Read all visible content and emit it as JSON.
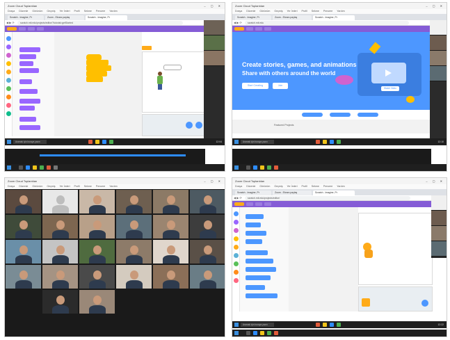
{
  "pane1": {
    "title": "Zoom Cloud Toplantıları",
    "menu": [
      "Dosya",
      "Düzenle",
      "Görünüm",
      "Geçmiş",
      "Yer İmleri",
      "Profil",
      "Sekme",
      "Pencere",
      "Yardım"
    ],
    "tabs": [
      "Scratch - Imagine, Pr",
      "Zoom - Ekranı paylaş",
      "Scratch - Imagine, Pr"
    ],
    "url": "scratch.mit.edu/projects/editor/?tutorial=getStarted",
    "taskbar_search": "Aramak için buraya yazın",
    "clock": "12:04"
  },
  "pane2": {
    "title": "Zoom Cloud Toplantıları",
    "menu": [
      "Dosya",
      "Düzenle",
      "Görünüm",
      "Geçmiş",
      "Yer İmleri",
      "Profil",
      "Sekme",
      "Pencere",
      "Yardım"
    ],
    "tabs": [
      "Scratch - Imagine, Pr",
      "Zoom - Ekranı paylaş",
      "Scratch - Imagine, Pr"
    ],
    "url": "scratch.mit.edu",
    "hero_line1": "Create stories, games, and animations",
    "hero_line2": "Share with others around the world",
    "start_creating": "Start Creating",
    "join_label": "Join",
    "watch_video": "Watch Video",
    "featured": "Featured Projects",
    "taskbar_search": "Aramak için buraya yazın",
    "clock": "12:10"
  },
  "pane3": {
    "title": "Zoom Cloud Toplantıları",
    "menu": [
      "Dosya",
      "Düzenle",
      "Görünüm",
      "Geçmiş",
      "Yer İmleri",
      "Profil",
      "Sekme",
      "Pencere",
      "Yardım"
    ]
  },
  "pane4": {
    "title": "Zoom Cloud Toplantıları",
    "menu": [
      "Dosya",
      "Düzenle",
      "Görünüm",
      "Geçmiş",
      "Yer İmleri",
      "Profil",
      "Sekme",
      "Pencere",
      "Yardım"
    ],
    "tabs": [
      "Scratch - Imagine, Pr",
      "Zoom - Ekranı paylaş",
      "Scratch - Imagine, Pr"
    ],
    "url": "scratch.mit.edu/projects/editor/",
    "taskbar_search": "Aramak için buraya yazın",
    "clock": "12:22"
  },
  "colors": {
    "scratch_purple": "#855cd6",
    "scratch_blue": "#4d97ff",
    "scratch_orange": "#ffab19",
    "taskbar": "#1f1f1f"
  }
}
